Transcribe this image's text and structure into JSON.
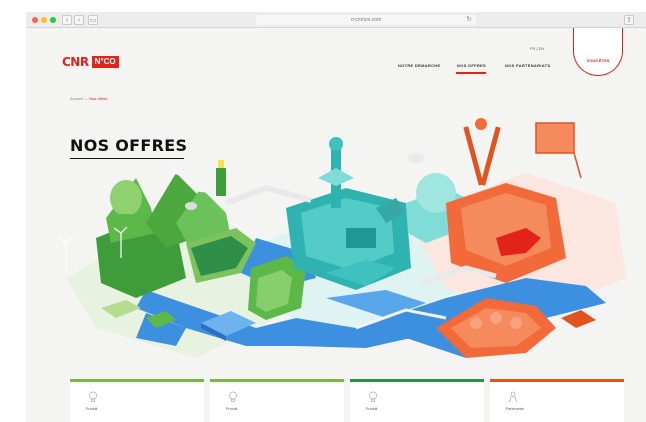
{
  "browser": {
    "url": "n-cnrnco.com",
    "back_glyph": "‹",
    "forward_glyph": "›",
    "sidebar_glyph": "▭",
    "reload_glyph": "↻",
    "share_glyph": "⇧",
    "traffic_colors": [
      "#ff5f57",
      "#febc2e",
      "#28c840"
    ]
  },
  "header": {
    "logo_text": "CNR",
    "logo_badge": "N°CO",
    "lang": "FR | EN",
    "nav": [
      "NOTRE DÉMARCHE",
      "NOS OFFRES",
      "NOS PARTENARIATS"
    ],
    "active_nav_index": 1,
    "cta": "VOUS ÊTES"
  },
  "breadcrumb": {
    "home": "Accueil",
    "separator": "—",
    "current": "Nos offres"
  },
  "page_title": "NOS OFFRES",
  "cards": [
    {
      "label": "Produit",
      "color": "#7ab648",
      "icon": "lightbulb-icon"
    },
    {
      "label": "Produit",
      "color": "#7ab648",
      "icon": "lightbulb-icon"
    },
    {
      "label": "Produit",
      "color": "#2f8f48",
      "icon": "lightbulb-icon"
    },
    {
      "label": "Partenariat",
      "color": "#e2541f",
      "icon": "person-icon"
    }
  ],
  "colors": {
    "brand_red": "#e2231a",
    "green": "#5cb848",
    "teal": "#3ec1bf",
    "orange": "#f26a3a",
    "water": "#3d8fe0"
  }
}
